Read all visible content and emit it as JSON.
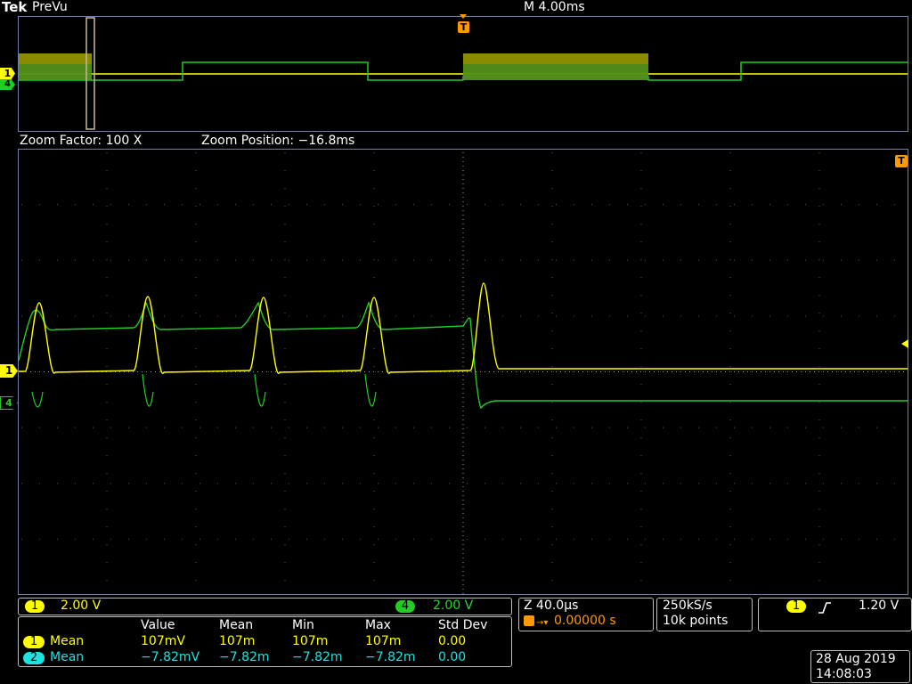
{
  "header": {
    "brand": "Tek",
    "mode": "PreVu",
    "timebase": "M 4.00ms",
    "trigger_marker": "T"
  },
  "zoom": {
    "factor_label": "Zoom Factor: 100 X",
    "position_label": "Zoom Position: −16.8ms"
  },
  "markers": {
    "ch1": "1",
    "ch4": "4",
    "trigger": "T"
  },
  "channels": {
    "ch1": {
      "badge": "1",
      "scale": "2.00 V",
      "color": "#ffff00"
    },
    "ch4": {
      "badge": "4",
      "scale": "2.00 V",
      "color": "#22cc22"
    }
  },
  "zoom_panel": {
    "timebase": "Z 40.0µs",
    "trigger_position": "0.00000 s"
  },
  "acquisition": {
    "sample_rate": "250kS/s",
    "record_length": "10k points"
  },
  "trigger": {
    "source_badge": "1",
    "slope_icon": "rising-edge",
    "level": "1.20 V"
  },
  "measurements": {
    "headers": [
      "Value",
      "Mean",
      "Min",
      "Max",
      "Std Dev"
    ],
    "rows": [
      {
        "badge": "1",
        "label": "Mean",
        "color": "#ffff00",
        "values": [
          "107mV",
          "107m",
          "107m",
          "107m",
          "0.00"
        ]
      },
      {
        "badge": "2",
        "label": "Mean",
        "color": "#22e0e0",
        "values": [
          "−7.82mV",
          "−7.82m",
          "−7.82m",
          "−7.82m",
          "0.00"
        ]
      }
    ]
  },
  "datetime": {
    "date": "28 Aug 2019",
    "time": "14:08:03"
  }
}
